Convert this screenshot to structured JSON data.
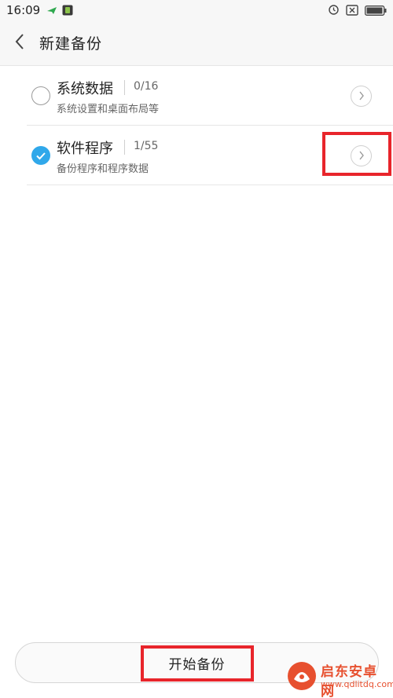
{
  "status_bar": {
    "time": "16:09"
  },
  "header": {
    "title": "新建备份"
  },
  "items": [
    {
      "title": "系统数据",
      "count": "0/16",
      "subtitle": "系统设置和桌面布局等",
      "checked": false
    },
    {
      "title": "软件程序",
      "count": "1/55",
      "subtitle": "备份程序和程序数据",
      "checked": true
    }
  ],
  "bottom": {
    "start_label": "开始备份"
  },
  "watermark": {
    "name": "启东安卓网",
    "url": "www.qdlitdq.com"
  },
  "colors": {
    "accent": "#30a8ea",
    "highlight": "#e8252b",
    "watermark": "#e7502f"
  }
}
